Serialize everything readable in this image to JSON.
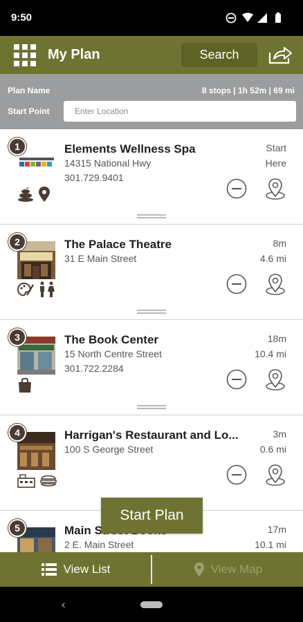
{
  "status_bar": {
    "time": "9:50"
  },
  "header": {
    "title": "My Plan",
    "search_label": "Search",
    "colors": {
      "bar": "#6f7331",
      "search": "#5e6225"
    }
  },
  "plan": {
    "name_label": "Plan Name",
    "stats": "8 stops | 1h 52m | 69 mi",
    "start_label": "Start Point",
    "start_placeholder": "Enter Location"
  },
  "stops": [
    {
      "number": "1",
      "name": "Elements Wellness Spa",
      "address": "14315 National Hwy",
      "phone": "301.729.9401",
      "time": "Start",
      "distance": "Here",
      "icons": [
        "spa-icon",
        "location-icon"
      ]
    },
    {
      "number": "2",
      "name": "The Palace Theatre",
      "address": "31 E Main Street",
      "phone": "",
      "time": "8m",
      "distance": "4.6 mi",
      "icons": [
        "arts-icon",
        "family-icon"
      ]
    },
    {
      "number": "3",
      "name": "The Book Center",
      "address": "15 North Centre Street",
      "phone": "301.722.2284",
      "time": "18m",
      "distance": "10.4 mi",
      "icons": [
        "shopping-bag-icon"
      ]
    },
    {
      "number": "4",
      "name": "Harrigan's Restaurant and Lo...",
      "address": "100 S George Street",
      "phone": "",
      "time": "3m",
      "distance": "0.6 mi",
      "icons": [
        "lodging-icon",
        "food-icon"
      ]
    },
    {
      "number": "5",
      "name": "Main Street Books",
      "address": "2 E. Main Street",
      "phone": "",
      "time": "17m",
      "distance": "10.1 mi",
      "icons": []
    }
  ],
  "actions": {
    "start_plan": "Start Plan"
  },
  "tabs": {
    "list": "View List",
    "map": "View Map"
  }
}
